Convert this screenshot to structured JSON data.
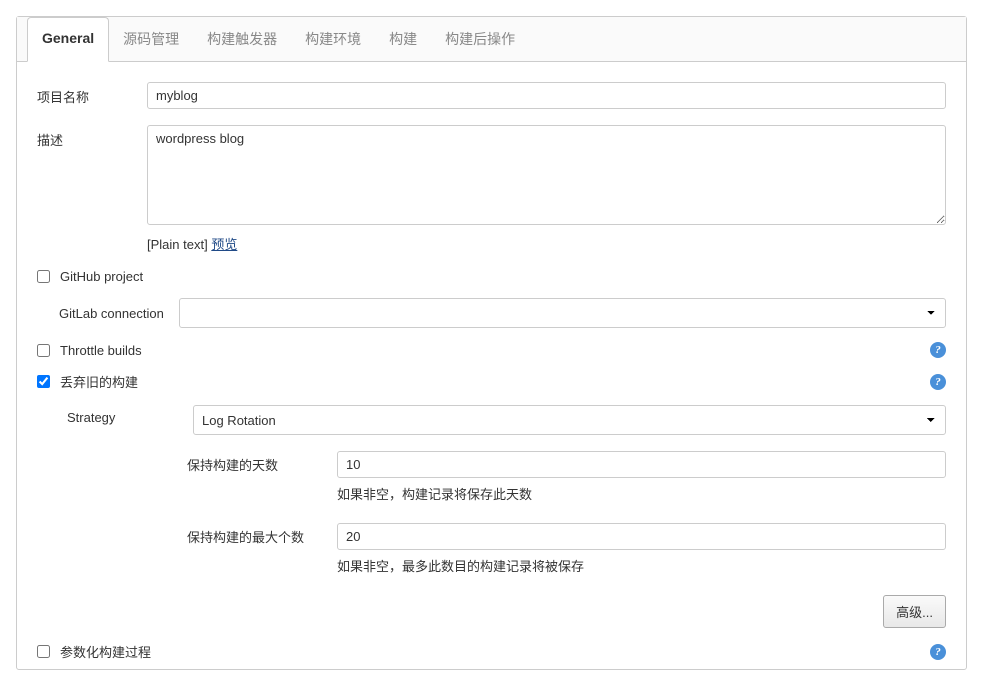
{
  "tabs": {
    "general": "General",
    "scm": "源码管理",
    "triggers": "构建触发器",
    "env": "构建环境",
    "build": "构建",
    "post": "构建后操作"
  },
  "labels": {
    "projectName": "项目名称",
    "description": "描述",
    "plainText": "[Plain text] ",
    "preview": "预览",
    "githubProject": "GitHub project",
    "gitlabConnection": "GitLab connection",
    "throttleBuilds": "Throttle builds",
    "discardOld": "丢弃旧的构建",
    "strategy": "Strategy",
    "daysToKeep": "保持构建的天数",
    "daysToKeepHelp": "如果非空，构建记录将保存此天数",
    "maxToKeep": "保持构建的最大个数",
    "maxToKeepHelp": "如果非空，最多此数目的构建记录将被保存",
    "advanced": "高级...",
    "parameterized": "参数化构建过程"
  },
  "values": {
    "projectName": "myblog",
    "description": "wordpress blog",
    "gitlabConnection": "",
    "strategy": "Log Rotation",
    "daysToKeep": "10",
    "maxToKeep": "20",
    "githubProjectChecked": false,
    "throttleBuildsChecked": false,
    "discardOldChecked": true,
    "parameterizedChecked": false
  }
}
